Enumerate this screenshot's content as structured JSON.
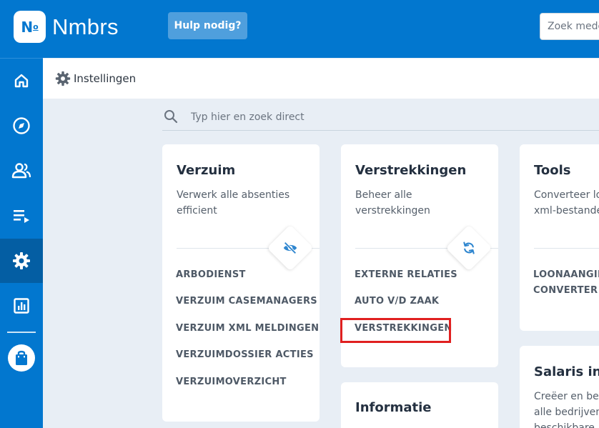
{
  "app": {
    "logo_mark": "N",
    "logo_sup": "o",
    "name": "Nmbrs",
    "help_label": "Hulp nodig?",
    "top_search_placeholder": "Zoek medewerker"
  },
  "sidebar": {
    "items": [
      {
        "icon": "home-icon",
        "active": false
      },
      {
        "icon": "compass-icon",
        "active": false
      },
      {
        "icon": "people-icon",
        "active": false
      },
      {
        "icon": "list-play-icon",
        "active": false
      },
      {
        "icon": "gear-icon",
        "active": true
      },
      {
        "icon": "report-icon",
        "active": false
      }
    ],
    "bottom_icon": "shopping-bag-icon"
  },
  "header": {
    "title": "Instellingen",
    "icon": "gear-icon"
  },
  "search": {
    "placeholder": "Typ hier en zoek direct"
  },
  "cards": {
    "verzuim": {
      "title": "Verzuim",
      "desc_line1": "Verwerk alle absenties",
      "desc_line2": "efficient",
      "icon": "eye-off-icon",
      "links": [
        "ARBODIENST",
        "VERZUIM CASEMANAGERS",
        "VERZUIM XML MELDINGEN",
        "VERZUIMDOSSIER ACTIES",
        "VERZUIMOVERZICHT"
      ]
    },
    "verstrekkingen": {
      "title": "Verstrekkingen",
      "desc_line1": "Beheer alle",
      "desc_line2": "verstrekkingen",
      "icon": "refresh-icon",
      "links": [
        "EXTERNE RELATIES",
        "AUTO V/D ZAAK",
        "VERSTREKKINGEN"
      ]
    },
    "informatie": {
      "title": "Informatie"
    },
    "tools": {
      "title": "Tools",
      "desc_line1": "Converteer loonaangifte",
      "desc_line2": "xml-bestanden",
      "links": [
        "LOONAANGIFTE",
        "CONVERTER"
      ]
    },
    "salaris": {
      "title": "Salaris instellingen",
      "desc_line1": "Creëer en beheer",
      "desc_line2": "alle bedrijven",
      "desc_line3": "beschikbare"
    }
  },
  "colors": {
    "brand": "#0277cf",
    "sidebar_active": "#045ea3",
    "highlight": "#e02020",
    "accent_icon": "#2f86cf"
  }
}
